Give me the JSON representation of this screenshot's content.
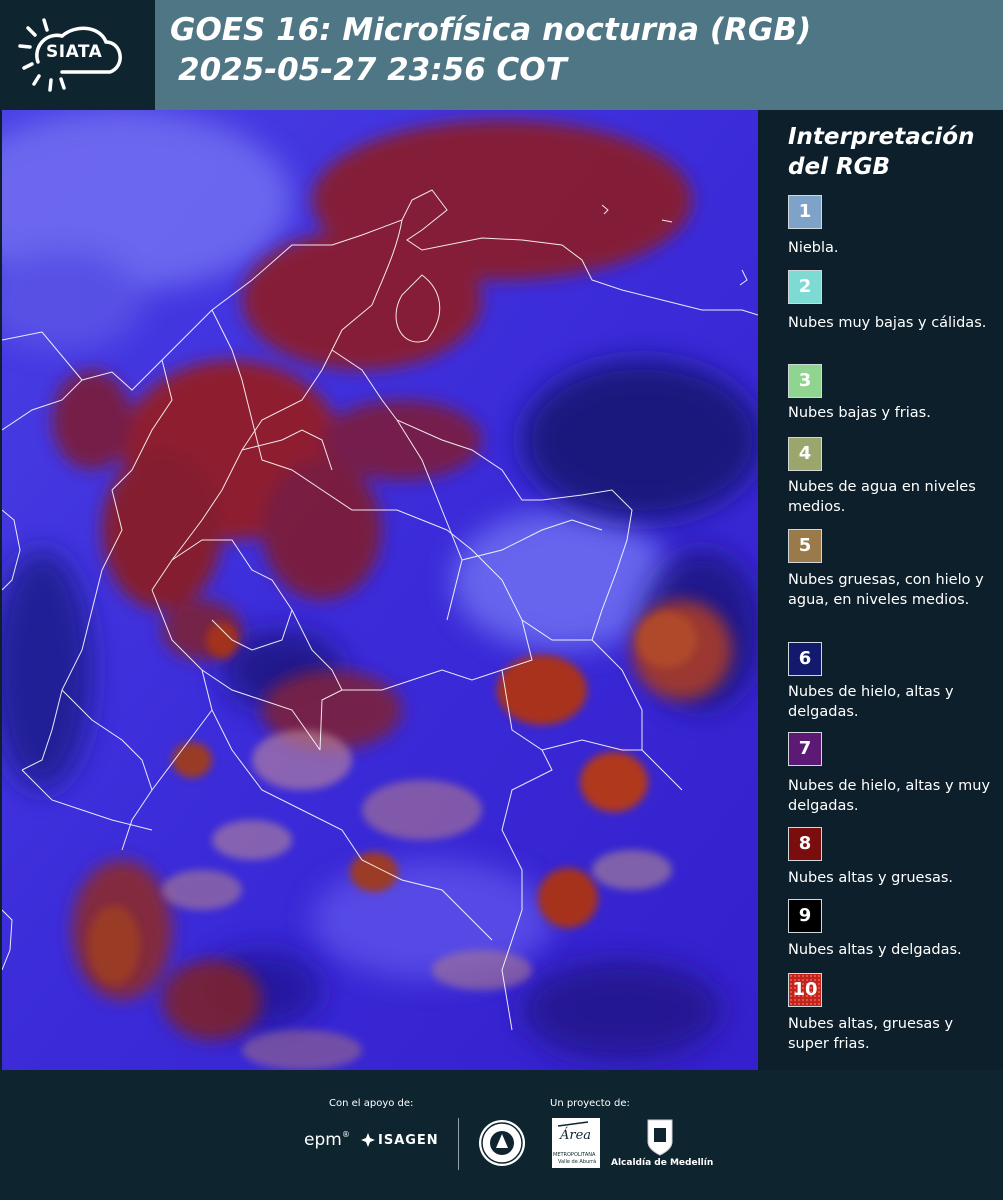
{
  "header": {
    "logo_text": "SIATA",
    "title_line1": "GOES 16: Microfísica nocturna (RGB)",
    "title_line2": "2025-05-27 23:56 COT"
  },
  "legend": {
    "title": "Interpretación del RGB",
    "items": [
      {
        "number": "1",
        "label": "Niebla.",
        "color": "#7fa2c8"
      },
      {
        "number": "2",
        "label": "Nubes muy bajas y cálidas.",
        "color": "#7ddbd3"
      },
      {
        "number": "3",
        "label": "Nubes bajas y frias.",
        "color": "#8fd48f"
      },
      {
        "number": "4",
        "label": "Nubes de agua en niveles medios.",
        "color": "#9aa66b"
      },
      {
        "number": "5",
        "label": "Nubes gruesas, con hielo y agua, en niveles medios.",
        "color": "#9a7a4a"
      },
      {
        "number": "6",
        "label": "Nubes de hielo, altas y delgadas.",
        "color": "#131a6e"
      },
      {
        "number": "7",
        "label": "Nubes de hielo, altas y muy delgadas.",
        "color": "#5c1a74"
      },
      {
        "number": "8",
        "label": "Nubes altas y gruesas.",
        "color": "#7a0e0e"
      },
      {
        "number": "9",
        "label": "Nubes altas y delgadas.",
        "color": "#000000"
      },
      {
        "number": "10",
        "label": "Nubes altas, gruesas y super frias.",
        "color": "#c4231b"
      }
    ]
  },
  "footer": {
    "support_label": "Con el apoyo de:",
    "project_label": "Un proyecto de:",
    "epm": "epm",
    "isagen": "ISAGEN",
    "area_name": "Área",
    "area_sub1": "METROPOLITANA",
    "area_sub2": "Valle de Aburrá",
    "medellin": "Alcaldía de Medellín"
  },
  "colors": {
    "header_bg": "#4f7684",
    "dark_bg": "#0e2530",
    "map_base": "#3a2ad8"
  }
}
